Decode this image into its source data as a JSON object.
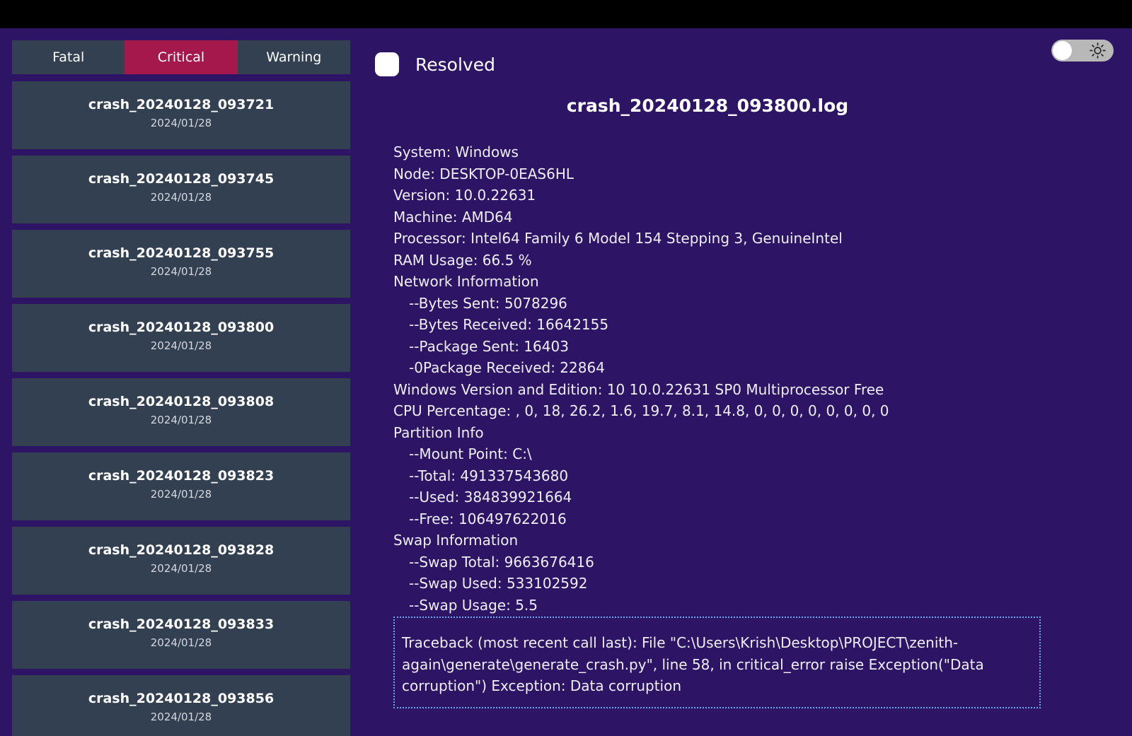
{
  "tabs": [
    {
      "label": "Fatal"
    },
    {
      "label": "Critical"
    },
    {
      "label": "Warning"
    }
  ],
  "crashes": [
    {
      "name": "crash_20240128_093721",
      "date": "2024/01/28"
    },
    {
      "name": "crash_20240128_093745",
      "date": "2024/01/28"
    },
    {
      "name": "crash_20240128_093755",
      "date": "2024/01/28"
    },
    {
      "name": "crash_20240128_093800",
      "date": "2024/01/28"
    },
    {
      "name": "crash_20240128_093808",
      "date": "2024/01/28"
    },
    {
      "name": "crash_20240128_093823",
      "date": "2024/01/28"
    },
    {
      "name": "crash_20240128_093828",
      "date": "2024/01/28"
    },
    {
      "name": "crash_20240128_093833",
      "date": "2024/01/28"
    },
    {
      "name": "crash_20240128_093856",
      "date": "2024/01/28"
    }
  ],
  "resolved_label": "Resolved",
  "log_title": "crash_20240128_093800.log",
  "info_lines": [
    {
      "text": "System: Windows",
      "sub": false
    },
    {
      "text": "Node: DESKTOP-0EAS6HL",
      "sub": false
    },
    {
      "text": "Version: 10.0.22631",
      "sub": false
    },
    {
      "text": "Machine: AMD64",
      "sub": false
    },
    {
      "text": "Processor: Intel64 Family 6 Model 154 Stepping 3, GenuineIntel",
      "sub": false
    },
    {
      "text": "RAM Usage: 66.5 %",
      "sub": false
    },
    {
      "text": "Network Information",
      "sub": false
    },
    {
      "text": "--Bytes Sent: 5078296",
      "sub": true
    },
    {
      "text": "--Bytes Received: 16642155",
      "sub": true
    },
    {
      "text": "--Package Sent: 16403",
      "sub": true
    },
    {
      "text": "-0Package Received: 22864",
      "sub": true
    },
    {
      "text": "Windows Version and Edition: 10 10.0.22631 SP0 Multiprocessor Free",
      "sub": false
    },
    {
      "text": "CPU Percentage: , 0, 18, 26.2, 1.6, 19.7, 8.1, 14.8, 0, 0, 0, 0, 0, 0, 0, 0",
      "sub": false
    },
    {
      "text": "Partition Info",
      "sub": false
    },
    {
      "text": "--Mount Point: C:\\",
      "sub": true
    },
    {
      "text": "--Total: 491337543680",
      "sub": true
    },
    {
      "text": "--Used: 384839921664",
      "sub": true
    },
    {
      "text": "--Free: 106497622016",
      "sub": true
    },
    {
      "text": "Swap Information",
      "sub": false
    },
    {
      "text": "--Swap Total: 9663676416",
      "sub": true
    },
    {
      "text": "--Swap Used: 533102592",
      "sub": true
    },
    {
      "text": "--Swap Usage: 5.5",
      "sub": true
    }
  ],
  "traceback": "Traceback (most recent call last): File \"C:\\Users\\Krish\\Desktop\\PROJECT\\zenith-again\\generate\\generate_crash.py\", line 58, in critical_error raise Exception(\"Data corruption\") Exception: Data corruption",
  "colors": {
    "background": "#2d1464",
    "topbar": "#000000",
    "panel": "#334052",
    "active_tab": "#a4184c",
    "traceback_border": "#6fa8e8"
  },
  "icons": {
    "theme_toggle": "sun-icon"
  }
}
